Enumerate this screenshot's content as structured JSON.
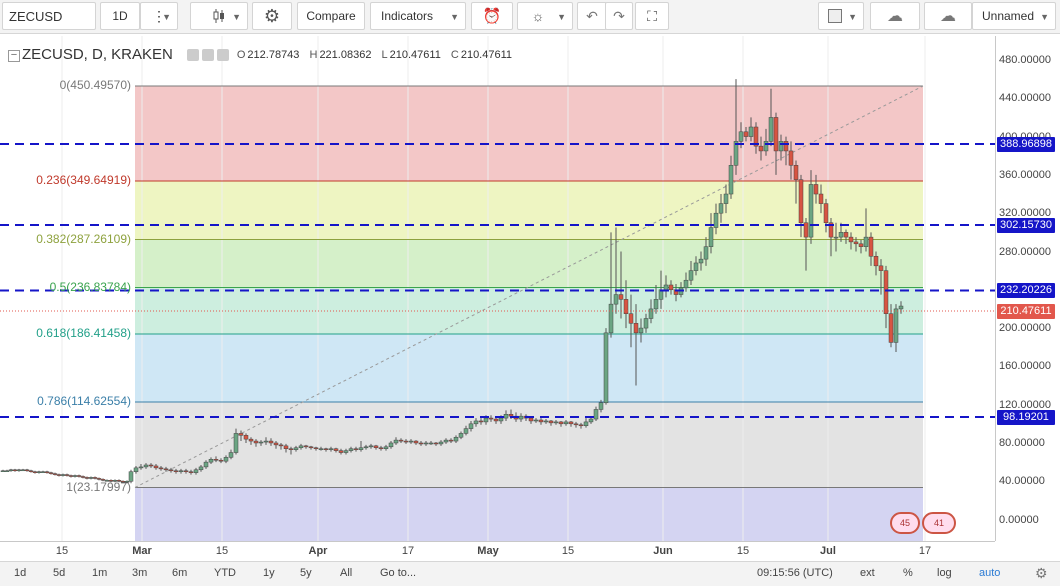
{
  "toolbar": {
    "symbol": "ZECUSD",
    "interval": "1D",
    "compare": "Compare",
    "indicators": "Indicators",
    "layout_name": "Unnamed"
  },
  "legend": {
    "title": "ZECUSD, D, KRAKEN",
    "o_label": "O",
    "o": "212.78743",
    "h_label": "H",
    "h": "221.08362",
    "l_label": "L",
    "l": "210.47611",
    "c_label": "C",
    "c": "210.47611"
  },
  "fib_levels": [
    {
      "label": "0(450.49570)",
      "color": "#787878"
    },
    {
      "label": "0.236(349.64919)",
      "color": "#c0392b"
    },
    {
      "label": "0.382(287.26109)",
      "color": "#8ea23e"
    },
    {
      "label": "0.5(236.83784)",
      "color": "#3aa34e"
    },
    {
      "label": "0.618(186.41458)",
      "color": "#22a089"
    },
    {
      "label": "0.786(114.62554)",
      "color": "#3b7fa8"
    },
    {
      "label": "1(23.17997)",
      "color": "#787878"
    }
  ],
  "price_axis": {
    "ticks": [
      "480.00000",
      "440.00000",
      "400.00000",
      "360.00000",
      "320.00000",
      "280.00000",
      "240.00000",
      "200.00000",
      "160.00000",
      "120.00000",
      "80.00000",
      "40.00000",
      "0.00000"
    ],
    "markers": [
      {
        "label": "388.96898",
        "kind": "line"
      },
      {
        "label": "302.15730",
        "kind": "line"
      },
      {
        "label": "232.20226",
        "kind": "line"
      },
      {
        "label": "210.47611",
        "kind": "last"
      },
      {
        "label": "98.19201",
        "kind": "line"
      }
    ]
  },
  "time_axis": {
    "labels": [
      {
        "text": "15",
        "major": false
      },
      {
        "text": "Mar",
        "major": true
      },
      {
        "text": "15",
        "major": false
      },
      {
        "text": "Apr",
        "major": true
      },
      {
        "text": "17",
        "major": false
      },
      {
        "text": "May",
        "major": true
      },
      {
        "text": "15",
        "major": false
      },
      {
        "text": "Jun",
        "major": true
      },
      {
        "text": "15",
        "major": false
      },
      {
        "text": "Jul",
        "major": true
      },
      {
        "text": "17",
        "major": false
      }
    ]
  },
  "bottom_bar": {
    "ranges": [
      "1d",
      "5d",
      "1m",
      "3m",
      "6m",
      "YTD",
      "1y",
      "5y",
      "All"
    ],
    "goto": "Go to...",
    "time": "09:15:56 (UTC)",
    "ext": "ext",
    "percent": "%",
    "log": "log",
    "auto": "auto"
  },
  "colors": {
    "up": "#6ba583",
    "down": "#d75442",
    "hline": "#1515c8",
    "last": "#e2574c"
  }
}
